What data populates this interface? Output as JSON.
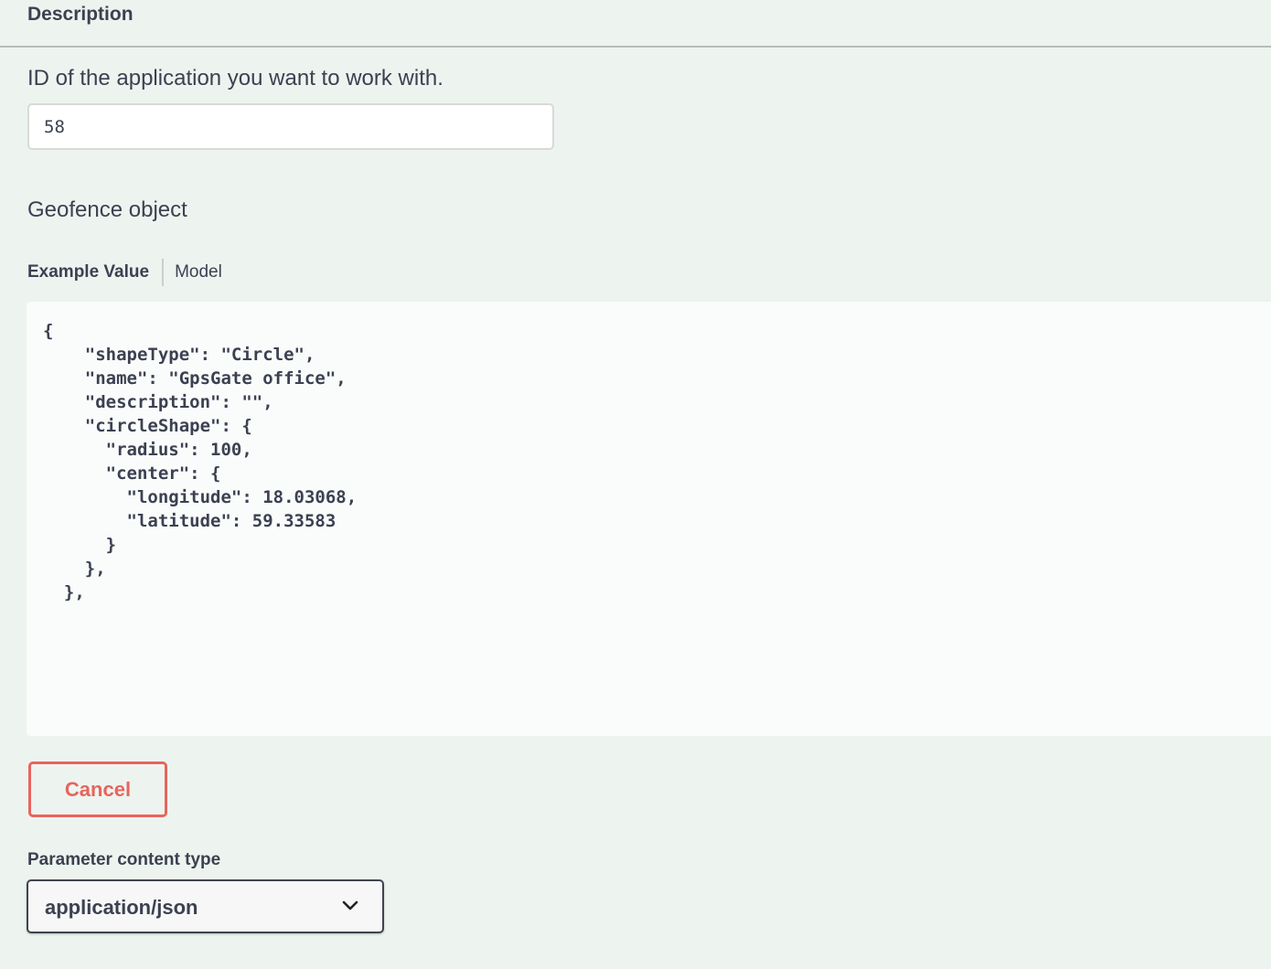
{
  "header": {
    "title": "Description"
  },
  "application_param": {
    "description": "ID of the application you want to work with.",
    "value": "58"
  },
  "body_param": {
    "description": "Geofence object",
    "tabs": [
      {
        "label": "Example Value",
        "active": true
      },
      {
        "label": "Model",
        "active": false
      }
    ],
    "example_code": "{\n    \"shapeType\": \"Circle\",\n    \"name\": \"GpsGate office\",\n    \"description\": \"\",\n    \"circleShape\": {\n      \"radius\": 100,\n      \"center\": {\n        \"longitude\": 18.03068,\n        \"latitude\": 59.33583\n      }\n    },\n  },"
  },
  "actions": {
    "cancel_label": "Cancel"
  },
  "content_type": {
    "label": "Parameter content type",
    "selected": "application/json"
  },
  "icons": {
    "dropdown": "chevron-down-icon"
  },
  "colors": {
    "background": "#edf4ef",
    "code_background": "#fafcfb",
    "cancel": "#e8645c",
    "text": "#3b4151"
  }
}
